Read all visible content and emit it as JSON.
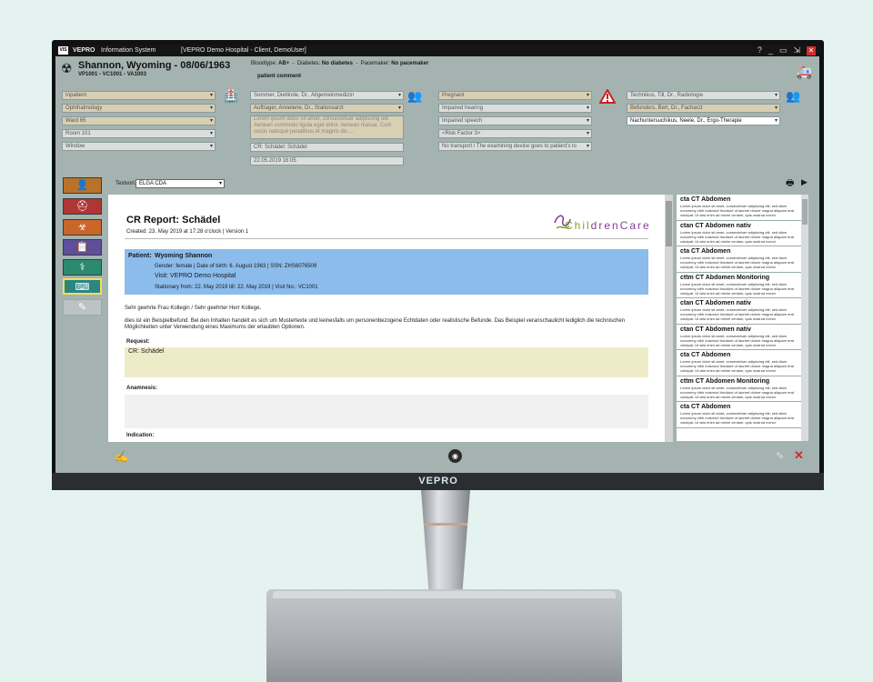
{
  "titlebar": {
    "app_name": "VEPRO",
    "app_sub": "Information System",
    "window_title": "[VEPRO Demo Hospital - Client, DemoUser]",
    "logo": "VIS",
    "icons": [
      "help-icon",
      "minimize-icon",
      "restore-icon",
      "logout-icon",
      "close-icon"
    ]
  },
  "patient": {
    "name": "Shannon, Wyoming - 08/06/1963",
    "ids": "VP1001  -  VC1001  -  VA1003",
    "bloodtype_label": "Bloodtype:",
    "bloodtype": "AB+",
    "diabetes_label": "Diabetes:",
    "diabetes": "No diabetes",
    "pacemaker_label": "Pacemaker:",
    "pacemaker": "No pacemaker",
    "comment": "patient comment"
  },
  "fields": {
    "col1": [
      "Inpatient",
      "Ophthalmology",
      "Ward 65",
      "Room 101",
      "Window"
    ],
    "col2": [
      "Sommer, Dietlinde, Dr., Allgemeinmedizin",
      "Auftrager, Annelene, Dr., Stationsarzt"
    ],
    "memo": "Lorem ipsum dolor sit amet, consectetuer adipiscing elit. Aenean commodo ligula eget dolor. Aenean massa. Cum sociis natoque penatibus et magnis dis ...",
    "cr": "CR: Schädel: Schädel",
    "datetime": "22.05.2019 16:05",
    "col3": [
      "Pregnant",
      "Impaired hearing",
      "Impaired speech",
      "<Risk Factor 3>",
      "No transport / The examining device goes to patient's lo"
    ],
    "col4": [
      "Technikus, Till, Dr., Radiologie",
      "Befunders, Bert, Dr., Facharzt",
      "Nachuntersuchikus, Neele, Dr., Ergo-Therapie"
    ]
  },
  "nav_buttons": [
    {
      "name": "patient",
      "color": "#b8732a",
      "glyph": "👤"
    },
    {
      "name": "order",
      "color": "#b03535",
      "glyph": "⛑"
    },
    {
      "name": "exam",
      "color": "#c9662a",
      "glyph": "☣"
    },
    {
      "name": "report",
      "color": "#5f4e99",
      "glyph": "📋"
    },
    {
      "name": "doctor",
      "color": "#2c8a70",
      "glyph": "🩺"
    },
    {
      "name": "keyboard",
      "color": "#2a8585",
      "glyph": "⌨"
    },
    {
      "name": "disabled",
      "color": "#bcc4c3",
      "glyph": "✎"
    }
  ],
  "template": {
    "label": "Textvorl.:",
    "value": "ELGA CDA"
  },
  "document": {
    "title": "CR Report: Schädel",
    "created": "Created:  23. May 2019 at 17:28 o'clock | Version 1",
    "logo_a": "Chil",
    "logo_b": "drenCare",
    "patient_label": "Patient:",
    "patient_name": "Wyoming Shannon",
    "patient_details": "Gender: female | Date of birth: 6. August 1963 | SSN: ZHS6076509",
    "visit": "Visit:  VEPRO Demo Hospital",
    "stationary": "Stationary from: 22. May 2019 till: 22. May 2019 | Visit No.: VC1001",
    "greeting": "Sehr geehrte Frau Kollegin / Sehr geehrter Herr Kollege,",
    "body": "dies ist ein Beispielbefund. Bei den Inhalten handelt es sich um Mustertexte und keinesfalls um personenbezogene Echtdaten oder realistische Befunde. Das Beispiel veranschaulicht lediglich die technischen Möglichkeiten unter Verwendung eines Maximums der erlaubten Optionen.",
    "request_label": "Request:",
    "request_value": "CR: Schädel",
    "anamnesis_label": "Anamnesis:",
    "indication_label": "Indication:"
  },
  "right_list": {
    "lorem": "Lorem ipsum dolor sit amet, consectetuer adipiscing elit, sed diam nonummy nibh euismod tincidunt ut laoreet dolore magna aliquam erat volutpat. Ut wisi enim ad minim veniam, quis nostrud exerci",
    "items": [
      "cta CT Abdomen",
      "ctan CT Abdomen nativ",
      "cta CT Abdomen",
      "cttm CT Abdomen Monitoring",
      "ctan CT Abdomen nativ",
      "ctan CT Abdomen nativ",
      "cta CT Abdomen",
      "cttm CT Abdomen Monitoring",
      "cta CT Abdomen"
    ]
  },
  "monitor": {
    "brand": "VEPRO"
  }
}
